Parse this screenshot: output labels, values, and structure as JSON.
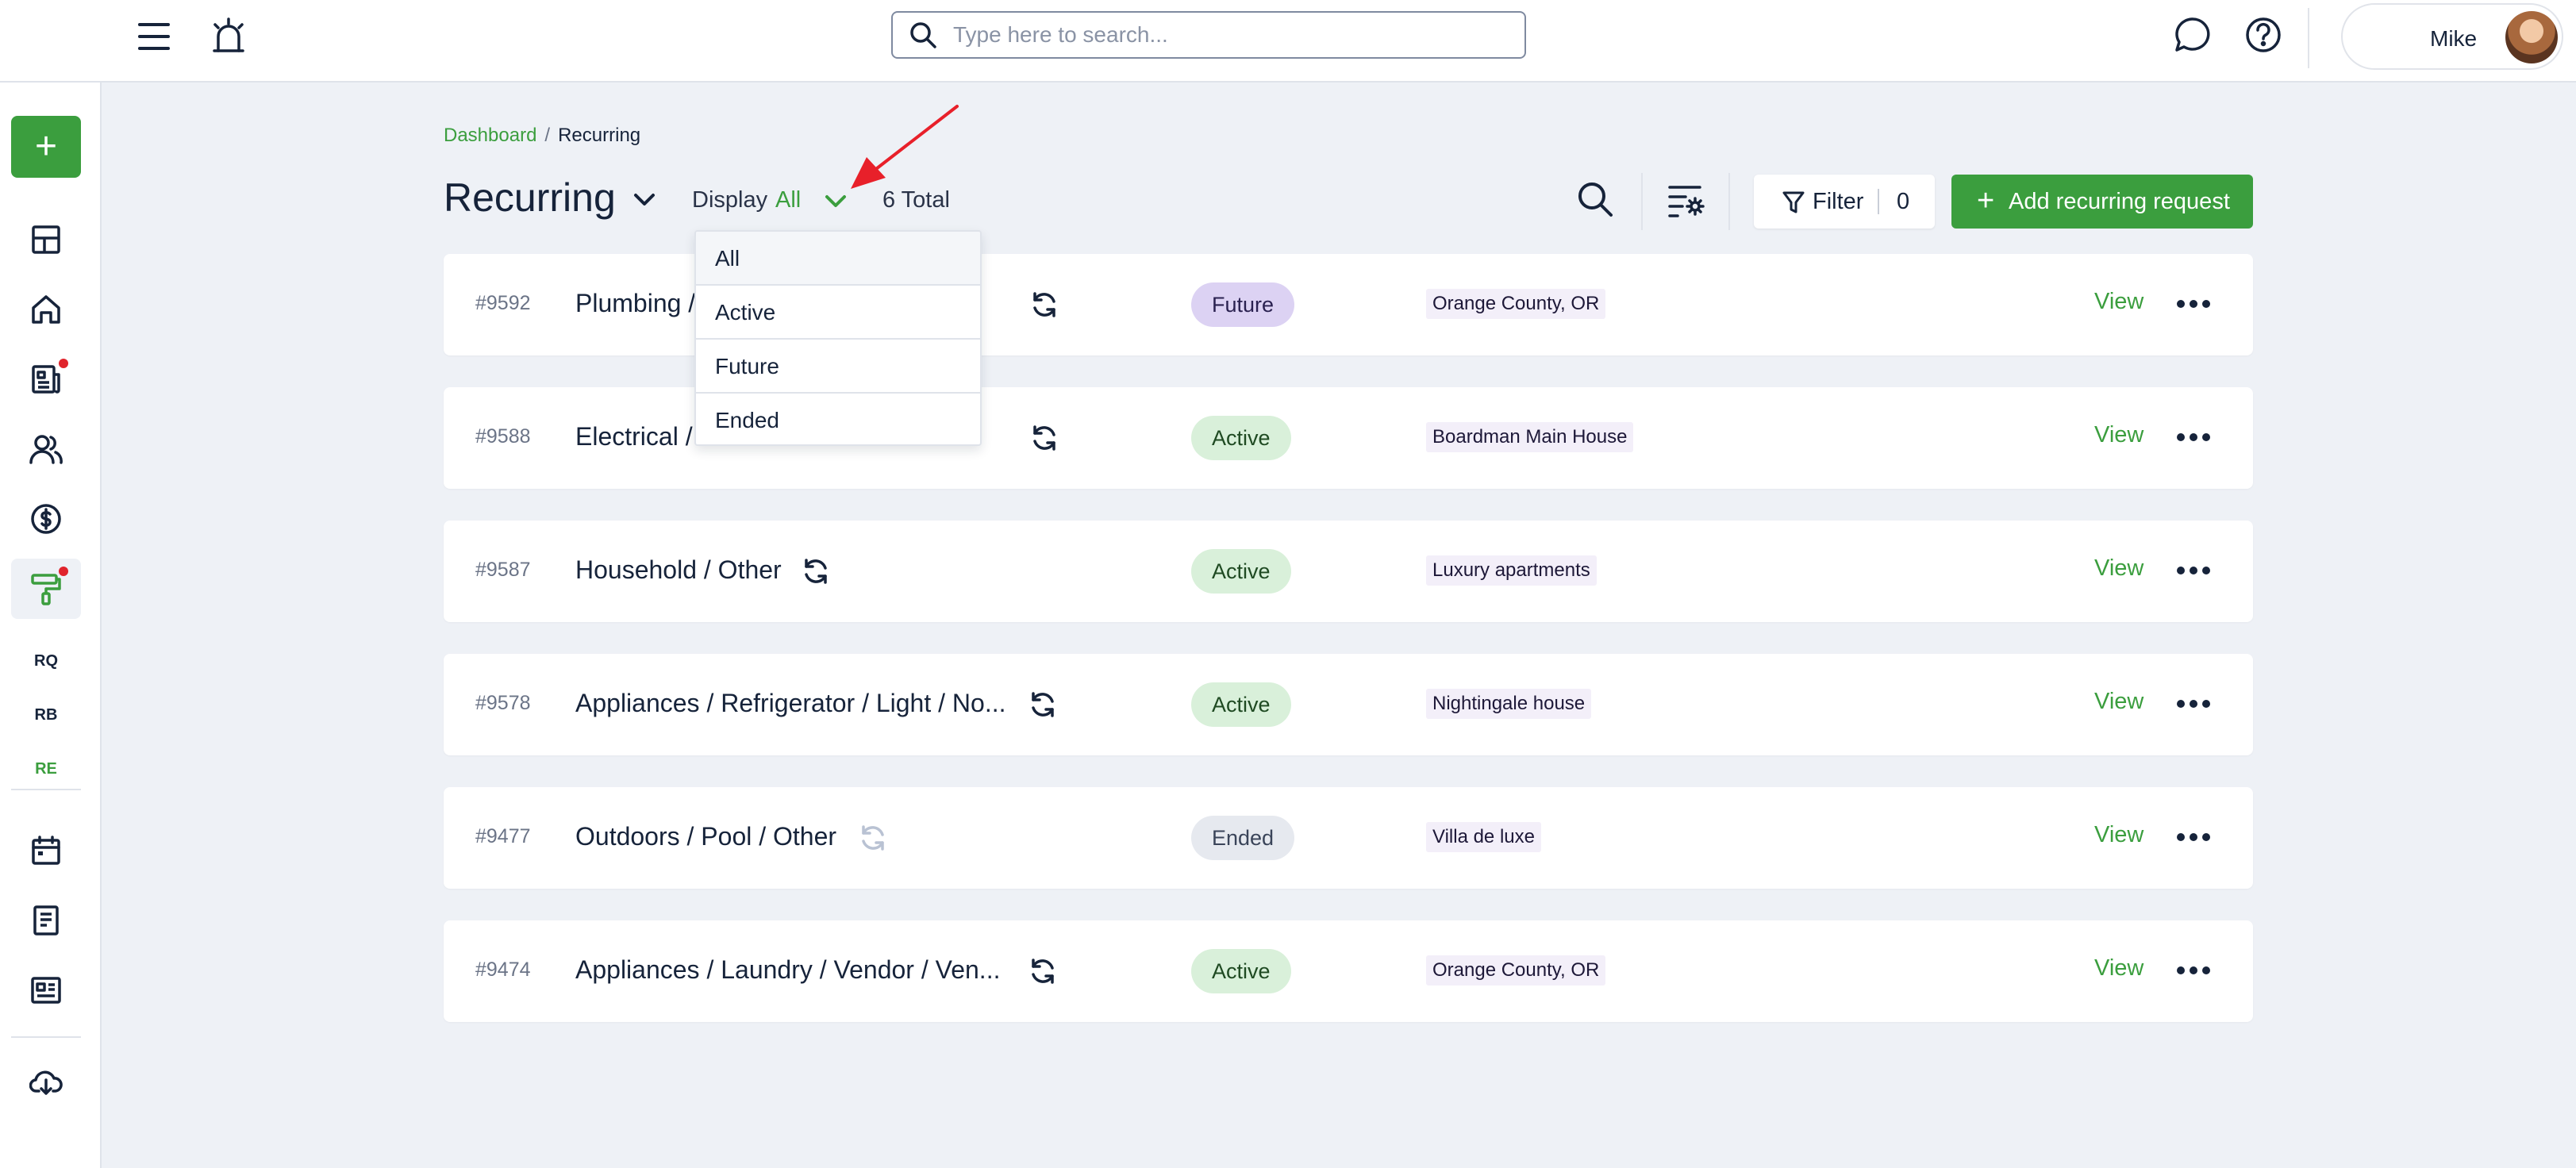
{
  "search": {
    "placeholder": "Type here to search..."
  },
  "user": {
    "name": "Mike"
  },
  "sidebar": {
    "add_label": "+",
    "sub_items": [
      {
        "label": "RQ"
      },
      {
        "label": "RB"
      },
      {
        "label": "RE"
      }
    ]
  },
  "breadcrumb": {
    "parent": "Dashboard",
    "separator": "/",
    "current": "Recurring"
  },
  "header": {
    "title": "Recurring",
    "display_label": "Display",
    "display_value": "All",
    "total": "6 Total",
    "filter_label": "Filter",
    "filter_count": "0",
    "add_label": "Add recurring request"
  },
  "dropdown": {
    "options": [
      {
        "label": "All"
      },
      {
        "label": "Active"
      },
      {
        "label": "Future"
      },
      {
        "label": "Ended"
      }
    ],
    "selected": "All"
  },
  "rows": [
    {
      "id": "#9592",
      "title": "Plumbing / ...",
      "status": "Future",
      "location": "Orange County, OR",
      "action": "View"
    },
    {
      "id": "#9588",
      "title": "Electrical / ...",
      "status": "Active",
      "location": "Boardman Main House",
      "action": "View"
    },
    {
      "id": "#9587",
      "title": "Household / Other",
      "status": "Active",
      "location": "Luxury apartments",
      "action": "View"
    },
    {
      "id": "#9578",
      "title": "Appliances / Refrigerator / Light / No...",
      "status": "Active",
      "location": "Nightingale house",
      "action": "View"
    },
    {
      "id": "#9477",
      "title": "Outdoors / Pool / Other",
      "status": "Ended",
      "location": "Villa de luxe",
      "action": "View"
    },
    {
      "id": "#9474",
      "title": "Appliances / Laundry / Vendor / Ven...",
      "status": "Active",
      "location": "Orange County, OR",
      "action": "View"
    }
  ],
  "colors": {
    "accent": "#3b9e3e",
    "future_badge": "#dcd2f3",
    "active_badge": "#d9f0da",
    "ended_badge": "#e6e9ef",
    "alert_dot": "#e0242c",
    "annotation_arrow": "#e8202a"
  }
}
